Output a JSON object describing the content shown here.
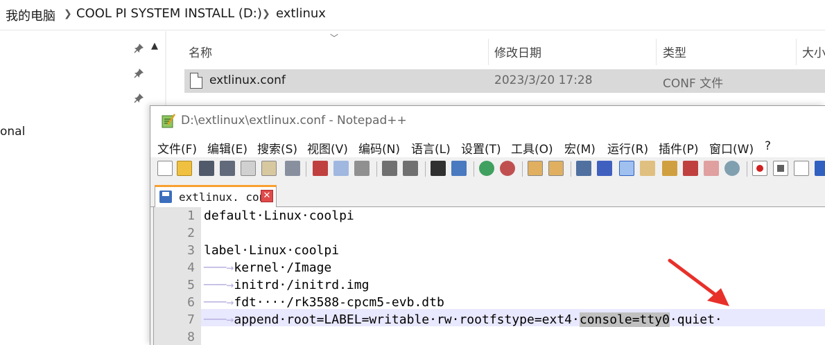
{
  "explorer": {
    "breadcrumb": [
      "我的电脑",
      "COOL PI SYSTEM INSTALL (D:)",
      "extlinux"
    ],
    "nav_partial_text": "onal",
    "columns": [
      "名称",
      "修改日期",
      "类型",
      "大小"
    ],
    "file": {
      "name": "extlinux.conf",
      "modified": "2023/3/20 17:28",
      "type": "CONF 文件"
    }
  },
  "notepad": {
    "title": "D:\\extlinux\\extlinux.conf - Notepad++",
    "menu": [
      "文件(F)",
      "编辑(E)",
      "搜索(S)",
      "视图(V)",
      "编码(N)",
      "语言(L)",
      "设置(T)",
      "工具(O)",
      "宏(M)",
      "运行(R)",
      "插件(P)",
      "窗口(W)",
      "?"
    ],
    "tab_label": "extlinux. conf",
    "tab_close": "✕",
    "line_numbers": [
      "1",
      "2",
      "3",
      "4",
      "5",
      "6",
      "7",
      "8"
    ],
    "lines": {
      "l1": "default·Linux·coolpi",
      "l3": "label·Linux·coolpi",
      "l4_code": "kernel·/Image",
      "l5_code": "initrd·/initrd.img",
      "l6_code": "fdt····/rk3588-cpcm5-evb.dtb",
      "l7_a": "append·root=LABEL=writable·rw·rootfstype=ext4·",
      "l7_hl": "console=tty0",
      "l7_b": "·quiet·",
      "tab_arrow": "───→"
    }
  },
  "colors": {
    "annotation_arrow": "#e8302a",
    "tab_accent": "#f9a030",
    "selected_row": "#d9d9d9"
  }
}
